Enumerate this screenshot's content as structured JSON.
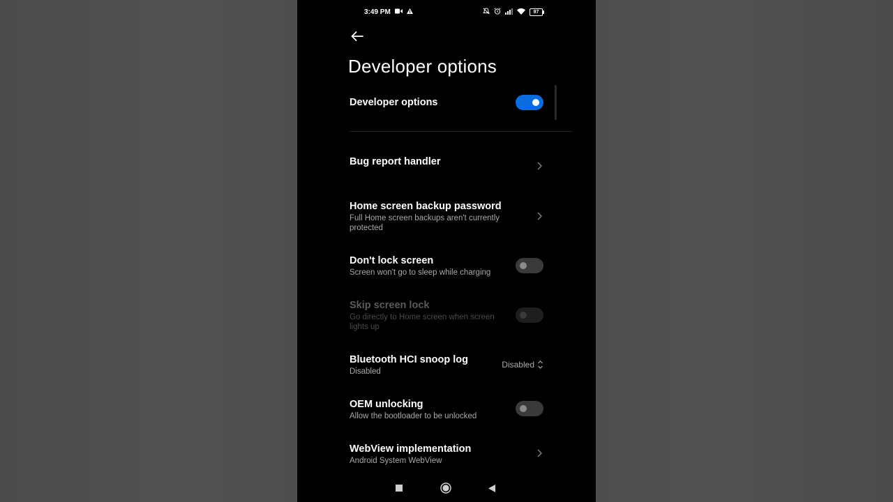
{
  "status_bar": {
    "time": "3:49 PM",
    "left_icons": [
      "video-camera-icon",
      "warning-icon"
    ],
    "right_icons": [
      "silent-bell-icon",
      "alarm-icon",
      "signal-icon",
      "wifi-icon"
    ],
    "battery": "97"
  },
  "header": {
    "back_icon": "back-arrow-icon",
    "title": "Developer options"
  },
  "master_toggle": {
    "label": "Developer options",
    "on": true
  },
  "settings": [
    {
      "title": "Bug report handler",
      "subtitle": "",
      "control": "chevron"
    },
    {
      "title": "Home screen backup password",
      "subtitle": "Full Home screen backups aren't currently protected",
      "control": "chevron"
    },
    {
      "title": "Don't lock screen",
      "subtitle": "Screen won't go to sleep while charging",
      "control": "toggle",
      "on": false
    },
    {
      "title": "Skip screen lock",
      "subtitle": "Go directly to Home screen when screen lights up",
      "control": "toggle",
      "on": false,
      "disabled": true
    },
    {
      "title": "Bluetooth HCI snoop log",
      "subtitle": "Disabled",
      "control": "select",
      "value": "Disabled"
    },
    {
      "title": "OEM unlocking",
      "subtitle": "Allow the bootloader to be unlocked",
      "control": "toggle",
      "on": false
    },
    {
      "title": "WebView implementation",
      "subtitle": "Android System WebView",
      "control": "chevron"
    }
  ],
  "nav_bar": {
    "items": [
      "recents-square-icon",
      "home-circle-icon",
      "back-triangle-icon"
    ]
  },
  "colors": {
    "accent": "#0b6ce0",
    "background": "#000000",
    "secondary_text": "#a8a8a8"
  }
}
